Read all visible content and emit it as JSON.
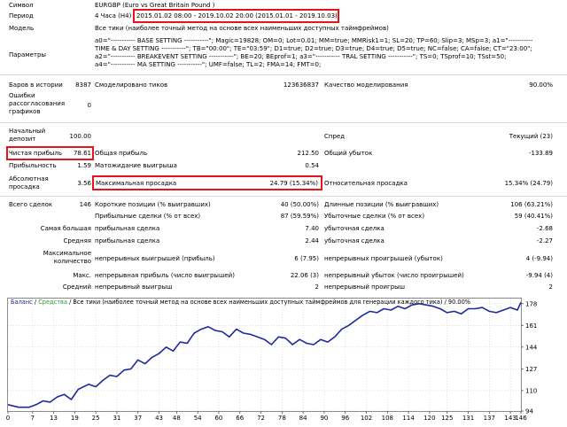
{
  "report": {
    "symbol_label": "Символ",
    "symbol_value": "EURGBP (Euro vs Great Britain Pound )",
    "period_label": "Период",
    "period_prefix": "4 Часа (H4)",
    "period_range": "2015.01.02 08:00 - 2019.10.02 20:00 (2015.01.01 - 2019.10.03)",
    "model_label": "Модель",
    "model_value": "Все тики (наиболее точный метод на основе всех наименьших доступных таймфреймов)",
    "params_label": "Параметры",
    "params_lines": [
      "a0=\"----------- BASE SETTING -----------\"; Magic=19828; OM=0; Lot=0.01; MM=true; MMRisk1=1; SL=20; TP=60; Slip=3; MSp=3; a1=\"-----------",
      "TIME & DAY SETTING -----------\"; TB=\"00:00\"; TE=\"03:59\"; D1=true; D2=true; D3=true; D4=true; D5=true; NC=false; CA=false; CT=\"23:00\";",
      "a2=\"----------- BREAKEVENT SETTING -----------\"; BE=20; BEprof=1; a3=\"----------- TRAL SETTING -----------\"; TS=0; TSprof=10; TSst=50;",
      "a4=\"----------- MA SETTING -----------\"; UMF=false; TL=2; FMA=14; FMT=0;"
    ],
    "bars_label": "Баров в истории",
    "bars_value": "8387",
    "ticks_label": "Смоделировано тиков",
    "ticks_value": "123636837",
    "quality_label": "Качество моделирования",
    "quality_value": "90.00%",
    "errors_label_1": "Ошибки",
    "errors_label_2": "рассогласования",
    "errors_label_3": "графиков",
    "errors_value": "0",
    "deposit_label_1": "Начальный",
    "deposit_label_2": "депозит",
    "deposit_value": "100.00",
    "spread_label": "Спред",
    "spread_value": "Текущий (23)",
    "net_profit_label": "Чистая прибыль",
    "net_profit_value": "78.61",
    "gross_profit_label": "Общая прибыль",
    "gross_profit_value": "212.50",
    "gross_loss_label": "Общий убыток",
    "gross_loss_value": "-133.89",
    "profit_factor_label": "Прибыльность",
    "profit_factor_value": "1.59",
    "expected_payoff_label": "Матожидание выигрыша",
    "expected_payoff_value": "0.54",
    "abs_dd_label_1": "Абсолютная",
    "abs_dd_label_2": "просадка",
    "abs_dd_value": "3.56",
    "max_dd_label": "Максимальная просадка",
    "max_dd_value": "24.79 (15.34%)",
    "rel_dd_label": "Относительная просадка",
    "rel_dd_value": "15.34% (24.79)",
    "total_trades_label": "Всего сделок",
    "total_trades_value": "146",
    "short_label": "Короткие позиции (% выигравших)",
    "short_value": "40 (50.00%)",
    "long_label": "Длинные позиции (% выигравших)",
    "long_value": "106 (63.21%)",
    "profit_trades_label": "Прибыльные сделки (% от всех)",
    "profit_trades_value": "87 (59.59%)",
    "loss_trades_label": "Убыточные сделки (% от всех)",
    "loss_trades_value": "59 (40.41%)",
    "largest_label": "Самая большая",
    "largest_profit_label": "прибыльная сделка",
    "largest_profit_value": "7.40",
    "largest_loss_label": "убыточная сделка",
    "largest_loss_value": "-2.68",
    "average_label": "Средняя",
    "average_profit_label": "прибыльная сделка",
    "average_profit_value": "2.44",
    "average_loss_label": "убыточная сделка",
    "average_loss_value": "-2.27",
    "max_label_1": "Максимальное",
    "max_label_2": "количество",
    "max_cons_wins_label": "непрерывных выигрышей (прибыль)",
    "max_cons_wins_value": "6 (7.95)",
    "max_cons_losses_label": "непрерывных проигрышей (убыток)",
    "max_cons_losses_value": "4 (-9.94)",
    "maximal_label": "Макс.",
    "maximal_profit_label": "непрерывная прибыль (число выигрышей)",
    "maximal_profit_value": "22.06 (3)",
    "maximal_loss_label": "непрерывный убыток (число проигрышей)",
    "maximal_loss_value": "-9.94 (4)",
    "avg_cons_label": "Средний",
    "avg_cons_wins_label": "непрерывный выигрыш",
    "avg_cons_wins_value": "2",
    "avg_cons_losses_label": "непрерывный проигрыш",
    "avg_cons_losses_value": "2"
  },
  "chart_header": {
    "balance": "Баланс",
    "slash": " / ",
    "equity": "Средства",
    "rest": " / Все тики (наиболее точный метод на основе всех наименьших доступных таймфреймов для генерации каждого тика) / 90.00%"
  },
  "colors": {
    "balance_line": "#1f2a9c",
    "balance_text": "#1f2a9c",
    "equity_text": "#2e9a2e",
    "highlight": "#e8141c",
    "grid": "#c8c8c8"
  },
  "chart_data": {
    "type": "line",
    "series": [
      {
        "name": "Баланс",
        "x": [
          0,
          3,
          6,
          8,
          10,
          12,
          14,
          16,
          18,
          20,
          23,
          25,
          27,
          29,
          31,
          33,
          35,
          37,
          39,
          41,
          43,
          45,
          47,
          49,
          51,
          53,
          55,
          57,
          59,
          61,
          63,
          65,
          67,
          69,
          71,
          73,
          75,
          77,
          79,
          81,
          83,
          85,
          87,
          89,
          91,
          93,
          95,
          97,
          99,
          101,
          103,
          105,
          107,
          109,
          111,
          113,
          115,
          117,
          119,
          121,
          123,
          125,
          127,
          129,
          131,
          133,
          135,
          137,
          139,
          141,
          143,
          145,
          146
        ],
        "values": [
          99,
          97,
          97,
          99,
          102,
          101,
          105,
          107,
          103,
          111,
          115,
          113,
          118,
          122,
          121,
          126,
          127,
          134,
          131,
          136,
          139,
          144,
          141,
          148,
          147,
          155,
          158,
          160,
          157,
          156,
          152,
          158,
          155,
          154,
          152,
          150,
          146,
          152,
          151,
          146,
          150,
          147,
          146,
          150,
          148,
          152,
          158,
          161,
          165,
          169,
          172,
          171,
          174,
          173,
          176,
          174,
          177,
          178,
          177,
          176,
          174,
          171,
          172,
          170,
          174,
          174,
          175,
          172,
          171,
          173,
          175,
          173,
          179
        ]
      }
    ],
    "x_ticks": [
      0,
      7,
      13,
      19,
      25,
      31,
      37,
      43,
      48,
      54,
      60,
      66,
      72,
      78,
      84,
      90,
      96,
      102,
      108,
      114,
      120,
      125,
      131,
      137,
      143,
      146
    ],
    "y_ticks": [
      94,
      110,
      127,
      144,
      161,
      178
    ],
    "xlim": [
      0,
      146
    ],
    "ylim": [
      94,
      182
    ],
    "grid": true
  }
}
